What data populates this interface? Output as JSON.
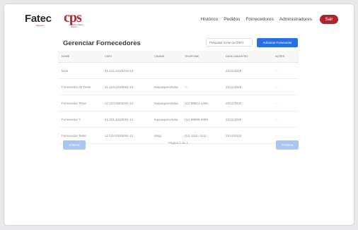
{
  "header": {
    "logo_fatec": "Fatec",
    "logo_fatec_sub": "Itaquera",
    "logo_cps": "cps",
    "logo_cps_sub": "Centro Paula Souza",
    "nav": [
      "Histórico",
      "Pedidos",
      "Fornecedores",
      "Administradores"
    ],
    "logout_label": "Sair"
  },
  "page": {
    "title": "Gerenciar Fornecedores",
    "search_placeholder": "Pesquisar nome ou CNPJ",
    "add_label": "Adicionar Fornecedor"
  },
  "table": {
    "columns": [
      "Nome",
      "CNPJ",
      "Cidade",
      "Telefone",
      "Data Cadastro",
      "Ações"
    ],
    "rows": [
      {
        "nome": "leslo",
        "cnpj": "41.241.241/0419-24",
        "cidade": "",
        "telefone": "",
        "data": "22/11/2025",
        "acoes": "···"
      },
      {
        "nome": "Fornecedor de Teste",
        "cnpj": "21.123.123/0001-23",
        "cidade": "Itaquaquecetuba",
        "telefone": "—",
        "data": "22/11/2025",
        "acoes": "···"
      },
      {
        "nome": "Fornecedor Teste",
        "cnpj": "12.123.456/0001-12",
        "cidade": "Itaquaquecetuba",
        "telefone": "(11) 99821-1456",
        "data": "22/11/2025",
        "acoes": "···"
      },
      {
        "nome": "Fornecedor Y",
        "cnpj": "21.321.423/0001-12",
        "cidade": "Itaquaquecetuba",
        "telefone": "(11) 99999-9999",
        "data": "22/11/2025",
        "acoes": "···"
      },
      {
        "nome": "Fornecedor Teste",
        "cnpj": "12.123.033/0001-12",
        "cidade": "Mogi",
        "telefone": "(11) 11111-1111",
        "data": "22/11/2025",
        "acoes": "···"
      }
    ]
  },
  "pagination": {
    "prev_label": "Anterior",
    "next_label": "Próxima",
    "page_info": "Página 1 de 1"
  }
}
